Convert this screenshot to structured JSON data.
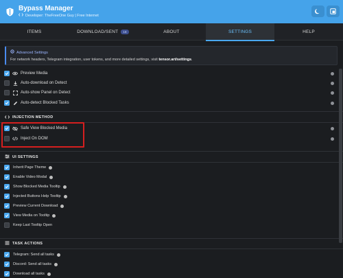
{
  "header": {
    "title": "Bypass Manager",
    "subtitle": "Developer: TheFreeOne Guy | Free Internet",
    "logo_icon": "shield-icon",
    "theme_button_icon": "moon-icon",
    "window_button_icon": "window-icon"
  },
  "tabs": [
    {
      "label": "ITEMS",
      "active": false
    },
    {
      "label": "DOWNLOAD/SENT",
      "badge": "18",
      "active": false
    },
    {
      "label": "ABOUT",
      "active": false
    },
    {
      "label": "SETTINGS",
      "active": true
    },
    {
      "label": "HELP",
      "active": false
    }
  ],
  "info": {
    "title": "Advanced Settings",
    "text_prefix": "For network headers, Telegram integration, user tokens, and more detailed settings, visit ",
    "link": "tensor.art/settings",
    "text_suffix": "."
  },
  "general": [
    {
      "label": "Preview Media",
      "checked": true,
      "icon": "eye-icon"
    },
    {
      "label": "Auto-download on Detect",
      "checked": false,
      "icon": "download-icon"
    },
    {
      "label": "Auto-show Panel on Detect",
      "checked": false,
      "icon": "expand-icon"
    },
    {
      "label": "Auto-detect Blocked Tasks",
      "checked": true,
      "icon": "pencil-icon"
    }
  ],
  "injection": {
    "title": "INJECTION METHOD",
    "items": [
      {
        "label": "Safe View Blocked Media",
        "checked": true,
        "icon": "eye-slash-icon"
      },
      {
        "label": "Inject On DOM",
        "checked": false,
        "icon": "code-icon"
      }
    ]
  },
  "ui_settings": {
    "title": "UI SETTINGS",
    "items": [
      {
        "label": "Inherit Page Theme",
        "checked": true
      },
      {
        "label": "Enable Video Modal",
        "checked": true
      },
      {
        "label": "Show Blocked Media Tooltip",
        "checked": true
      },
      {
        "label": "Injected Buttons Help Tooltip",
        "checked": true
      },
      {
        "label": "Preview Current Download",
        "checked": true
      },
      {
        "label": "View Media on Tooltip",
        "checked": true
      },
      {
        "label": "Keep Last Tooltip Open",
        "checked": false
      }
    ]
  },
  "task_actions": {
    "title": "TASK ACTIONS",
    "items": [
      {
        "label": "Telegram: Send all tasks",
        "checked": true
      },
      {
        "label": "Discord: Send all tasks",
        "checked": true
      },
      {
        "label": "Download all tasks",
        "checked": true
      }
    ]
  },
  "colors": {
    "header": "#45a3ea",
    "accent": "#4aa8f0",
    "highlight": "#d61f1f",
    "background": "#1b1d20"
  }
}
